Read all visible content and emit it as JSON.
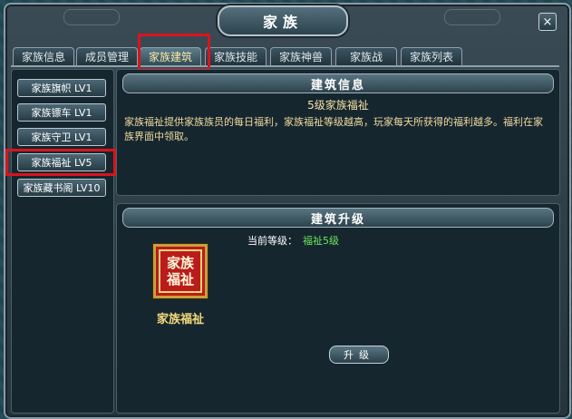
{
  "window": {
    "title": "家族",
    "close_label": "×"
  },
  "tabs": [
    {
      "label": "家族信息"
    },
    {
      "label": "成员管理"
    },
    {
      "label": "家族建筑"
    },
    {
      "label": "家族技能"
    },
    {
      "label": "家族神兽"
    },
    {
      "label": "家族战"
    },
    {
      "label": "家族列表"
    }
  ],
  "active_tab": "家族建筑",
  "buildings": [
    {
      "label": "家族旗帜 LV1"
    },
    {
      "label": "家族镖车 LV1"
    },
    {
      "label": "家族守卫 LV1"
    },
    {
      "label": "家族福祉 LV5"
    },
    {
      "label": "家族藏书阁 LV10"
    }
  ],
  "selected_building": "家族福祉 LV5",
  "info": {
    "header": "建筑信息",
    "subtitle": "5级家族福祉",
    "description": "家族福祉提供家族族员的每日福利，家族福祉等级越高，玩家每天所获得的福利越多。福利在家族界面中领取。"
  },
  "upgrade": {
    "header": "建筑升级",
    "icon_text": "家族福祉",
    "name": "家族福祉",
    "level_label": "当前等级：",
    "level_value": "福祉5级",
    "button_label": "升级"
  },
  "colors": {
    "highlight": "#d9141c",
    "level_value": "#6ee65c",
    "desc_text": "#f0dba0"
  }
}
